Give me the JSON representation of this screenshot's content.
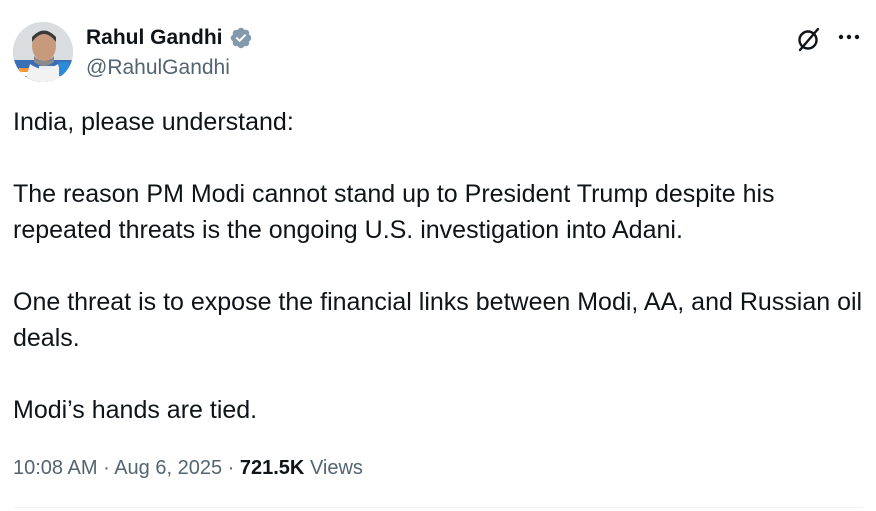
{
  "author": {
    "display_name": "Rahul Gandhi",
    "handle": "@RahulGandhi",
    "verified": true,
    "verified_color": "#829aab"
  },
  "tweet": {
    "paragraphs": [
      "India, please understand:",
      "The reason PM Modi cannot stand up to President Trump despite his repeated threats is the ongoing U.S. investigation into Adani.",
      "One threat is to expose the financial links between Modi, AA, and Russian oil deals.",
      "Modi’s hands are tied."
    ]
  },
  "meta": {
    "time": "10:08 AM",
    "separator": "·",
    "date": "Aug 6, 2025",
    "views_count": "721.5K",
    "views_label": "Views"
  },
  "icons": {
    "grok": "grok-icon",
    "more": "more-horizontal-icon",
    "verified": "verified-badge-icon"
  },
  "colors": {
    "text_primary": "#0f1419",
    "text_secondary": "#536471",
    "divider": "#eff3f4"
  }
}
